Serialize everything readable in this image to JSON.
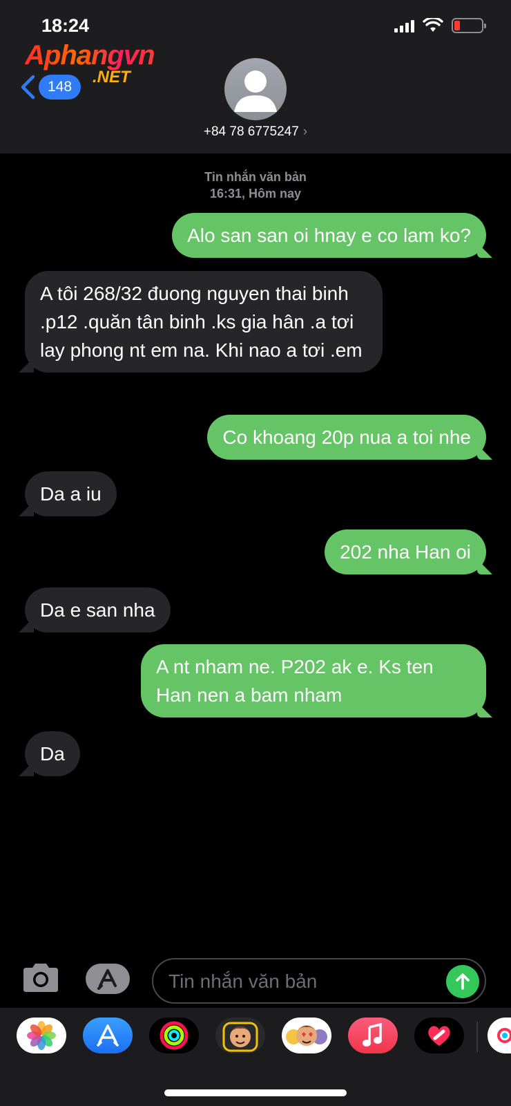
{
  "status_bar": {
    "time": "18:24"
  },
  "watermark": {
    "line1": "Aphangvn",
    "line2": ".NET"
  },
  "header": {
    "back_count": "148",
    "contact_number": "+84 78 6775247",
    "contact_chevron": "›"
  },
  "thread": {
    "timestamp_line1": "Tin nhắn văn bản",
    "timestamp_line2": "16:31, Hôm nay",
    "messages": [
      {
        "direction": "sent",
        "text": "Alo san san oi hnay e co lam ko?"
      },
      {
        "direction": "received",
        "text": "A tôi 268/32 đuong nguyen thai binh .p12 .quăn tân binh .ks gia hân .a tơi lay phong nt em na. Khi nao a tơi .em"
      },
      {
        "direction": "sent",
        "text": "Co khoang 20p nua a toi nhe"
      },
      {
        "direction": "received",
        "text": "Da a iu"
      },
      {
        "direction": "sent",
        "text": "202 nha Han oi"
      },
      {
        "direction": "received",
        "text": "Da e san nha"
      },
      {
        "direction": "sent",
        "text": "A nt nham ne. P202 ak e. Ks ten Han nen a bam nham"
      },
      {
        "direction": "received",
        "text": "Da"
      }
    ]
  },
  "compose": {
    "placeholder": "Tin nhắn văn bản"
  },
  "app_drawer": {
    "apps": [
      "photos-icon",
      "app-store-icon",
      "activity-icon",
      "memoji-icon",
      "memoji-stickers-icon",
      "music-icon",
      "digital-touch-icon",
      "more-apps-icon"
    ]
  },
  "colors": {
    "sent_bubble": "#65c466",
    "received_bubble": "#262628",
    "badge": "#2f7cf6",
    "send_button": "#34c759"
  }
}
